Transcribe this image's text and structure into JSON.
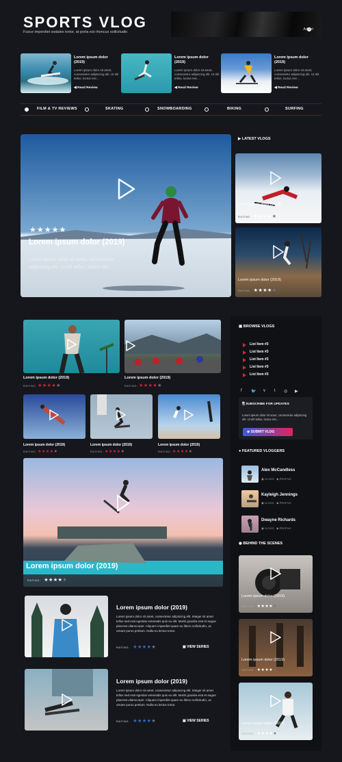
{
  "header": {
    "title": "SPORTS VLOG",
    "tagline": "Fusce imperdiet sodales tortor, at porta est rhoncus sollicitudin.",
    "advert_label": "Advert"
  },
  "reviews": [
    {
      "title": "Lorem ipsum dolor (2019)",
      "text": "Lorem ipsum dolor sit amet, consectetur adipiscing elit. Ut elit tellus, luctus nec...",
      "link": "Read Review"
    },
    {
      "title": "Lorem ipsum dolor (2019)",
      "text": "Lorem ipsum dolor sit amet, consectetur adipiscing elit. Ut elit tellus, luctus nec...",
      "link": "Read Review"
    },
    {
      "title": "Lorem ipsum dolor (2019)",
      "text": "Lorem ipsum dolor sit amet, consectetur adipiscing elit. Ut elit tellus, luctus nec...",
      "link": "Read Review"
    }
  ],
  "nav": [
    "FILM & TV REVIEWS",
    "SKATING",
    "SNOWBOARDING",
    "BIKING",
    "SURFING"
  ],
  "hero": {
    "stars": "★★★★★",
    "title": "Lorem ipsum dolor (2019)",
    "text": "Lorem ipsum dolor sit amet, consectetur adipiscing elit. Ut elit tellus, luctus nec..."
  },
  "latest": {
    "heading": "LATEST VLOGS",
    "items": [
      {
        "title": "Lorem ipsum dolor (2019)",
        "rating_label": "RATING",
        "stars": "★★★★",
        "empty": "★"
      },
      {
        "title": "Lorem ipsum dolor (2019)",
        "rating_label": "RATING",
        "stars": "★★★★",
        "empty": "★"
      }
    ]
  },
  "grid": {
    "large": [
      {
        "title": "Lorem ipsum dolor (2019)",
        "rating_label": "RATING:",
        "stars": "★★★★",
        "empty": "★"
      },
      {
        "title": "Lorem ipsum dolor (2019)",
        "rating_label": "RATING:",
        "stars": "★★★★",
        "empty": "★"
      }
    ],
    "small": [
      {
        "title": "Lorem ipsum dolor (2019)",
        "rating_label": "RATING:",
        "stars": "★★★★",
        "empty": "★"
      },
      {
        "title": "Lorem ipsum dolor (2019)",
        "rating_label": "RATING:",
        "stars": "★★★★",
        "empty": "★"
      },
      {
        "title": "Lorem ipsum dolor (2019)",
        "rating_label": "RATING:",
        "stars": "★★★★",
        "empty": "★"
      }
    ],
    "feature": {
      "title": "Lorem ipsum dolor (2019)",
      "rating_label": "RATING:",
      "stars": "★★★★",
      "empty": "★"
    }
  },
  "series": [
    {
      "title": "Lorem ipsum dolor (2019)",
      "text": "Lorem ipsum dolor sit amet, consectetur adipiscing elit. Integer sit amet tellus sed erat egestas venenatis quis eu elit. Morbi gravida erat et augue placerat ullamcorper. Aliquam imperdiet quam eu libero sollicitudin, ac ornare purus pretium. Nulla eu lectus tortor.",
      "rating_label": "RATING:",
      "stars": "★★★★",
      "empty": "★",
      "link": "VIEW SERIES"
    },
    {
      "title": "Lorem ipsum dolor (2019)",
      "text": "Lorem ipsum dolor sit amet, consectetur adipiscing elit. Integer sit amet tellus sed erat egestas venenatis quis eu elit. Morbi gravida erat et augue placerat ullamcorper. Aliquam imperdiet quam eu libero sollicitudin, ac ornare purus pretium. Nulla eu lectus tortor.",
      "rating_label": "RATING:",
      "stars": "★★★★",
      "empty": "★",
      "link": "VIEW SERIES"
    }
  ],
  "sidebar": {
    "browse_heading": "BROWSE VLOGS",
    "list": [
      "List Item #3",
      "List Item #3",
      "List Item #3",
      "List Item #3",
      "List Item #3"
    ],
    "social": [
      "f",
      "🐦",
      "v",
      "t",
      "◎",
      "▶"
    ],
    "subscribe": {
      "heading": "SUBSCRIBE FOR UPDATES",
      "text": "Lorem ipsum dolor sit amet, consectetur adipiscing elit. Ut elit tellus, luctus nec...",
      "button": "SUBMIT VLOG"
    },
    "featured_heading": "FEATURED VLOGGERS",
    "vloggers": [
      {
        "name": "Alex McCandless",
        "vlogs": "VLOGS",
        "profile": "PROFILE"
      },
      {
        "name": "Kayleigh Jennings",
        "vlogs": "VLOGS",
        "profile": "PROFILE"
      },
      {
        "name": "Dwayne Richards",
        "vlogs": "VLOGS",
        "profile": "PROFILE"
      }
    ],
    "bts_heading": "BEHIND THE SCENES",
    "bts": [
      {
        "title": "Lorem ipsum dolor (2019)",
        "rating_label": "RATING",
        "stars": "★★★★",
        "empty": "★"
      },
      {
        "title": "Lorem ipsum dolor (2019)",
        "rating_label": "RATING",
        "stars": "★★★★",
        "empty": "★"
      },
      {
        "title": "Lorem ipsum dolor (2019)",
        "rating_label": "RATING",
        "stars": "★★★★",
        "empty": "★"
      }
    ]
  }
}
